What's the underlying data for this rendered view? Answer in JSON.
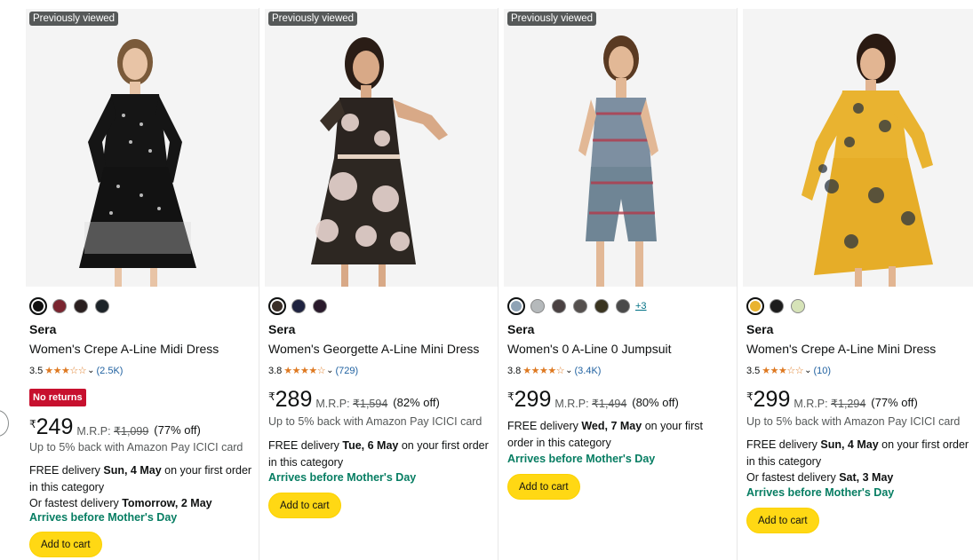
{
  "cards": [
    {
      "badge": "Previously viewed",
      "brand": "Sera",
      "title": "Women's Crepe A-Line Midi Dress",
      "rating": "3.5",
      "stars": "★★★☆☆",
      "reviews": "(2.5K)",
      "no_returns": "No returns",
      "currency": "₹",
      "price": "249",
      "mrp_label": "M.R.P:",
      "mrp": "₹1,099",
      "off": "(77% off)",
      "cashback": "Up to 5% back with Amazon Pay ICICI card",
      "delivery_prefix": "FREE delivery ",
      "delivery_date": "Sun, 4 May",
      "delivery_suffix": " on your first order in this category",
      "fastest_prefix": "Or fastest delivery ",
      "fastest_date": "Tomorrow, 2 May",
      "arrives": "Arrives before Mother's Day",
      "add_to_cart": "Add to cart",
      "swatches": [
        "#111111",
        "#7a2530",
        "#2a1f1f",
        "#1c2328"
      ]
    },
    {
      "badge": "Previously viewed",
      "brand": "Sera",
      "title": "Women's Georgette A-Line Mini Dress",
      "rating": "3.8",
      "stars": "★★★★☆",
      "reviews": "(729)",
      "currency": "₹",
      "price": "289",
      "mrp_label": "M.R.P:",
      "mrp": "₹1,594",
      "off": "(82% off)",
      "cashback": "Up to 5% back with Amazon Pay ICICI card",
      "delivery_prefix": "FREE delivery ",
      "delivery_date": "Tue, 6 May",
      "delivery_suffix": " on your first order in this category",
      "arrives": "Arrives before Mother's Day",
      "add_to_cart": "Add to cart",
      "swatches": [
        "#3a2f28",
        "#1f2340",
        "#2a1a2c"
      ]
    },
    {
      "badge": "Previously viewed",
      "brand": "Sera",
      "title": "Women's 0 A-Line 0 Jumpsuit",
      "rating": "3.8",
      "stars": "★★★★☆",
      "reviews": "(3.4K)",
      "currency": "₹",
      "price": "299",
      "mrp_label": "M.R.P:",
      "mrp": "₹1,494",
      "off": "(80% off)",
      "delivery_prefix": "FREE delivery ",
      "delivery_date": "Wed, 7 May",
      "delivery_suffix": " on your first order in this category",
      "arrives": "Arrives before Mother's Day",
      "add_to_cart": "Add to cart",
      "swatches": [
        "#8fa3b5",
        "#b5b9bb",
        "#4a4142",
        "#55504e",
        "#3a3420",
        "#4a4a4a"
      ],
      "more_swatches": "+3"
    },
    {
      "brand": "Sera",
      "title": "Women's Crepe A-Line Mini Dress",
      "rating": "3.5",
      "stars": "★★★☆☆",
      "reviews": "(10)",
      "currency": "₹",
      "price": "299",
      "mrp_label": "M.R.P:",
      "mrp": "₹1,294",
      "off": "(77% off)",
      "cashback": "Up to 5% back with Amazon Pay ICICI card",
      "delivery_prefix": "FREE delivery ",
      "delivery_date": "Sun, 4 May",
      "delivery_suffix": " on your first order in this category",
      "fastest_prefix": "Or fastest delivery ",
      "fastest_date": "Sat, 3 May",
      "arrives": "Arrives before Mother's Day",
      "add_to_cart": "Add to cart",
      "swatches": [
        "#e9b330",
        "#1c1c1c",
        "#d6e3b8"
      ]
    }
  ]
}
